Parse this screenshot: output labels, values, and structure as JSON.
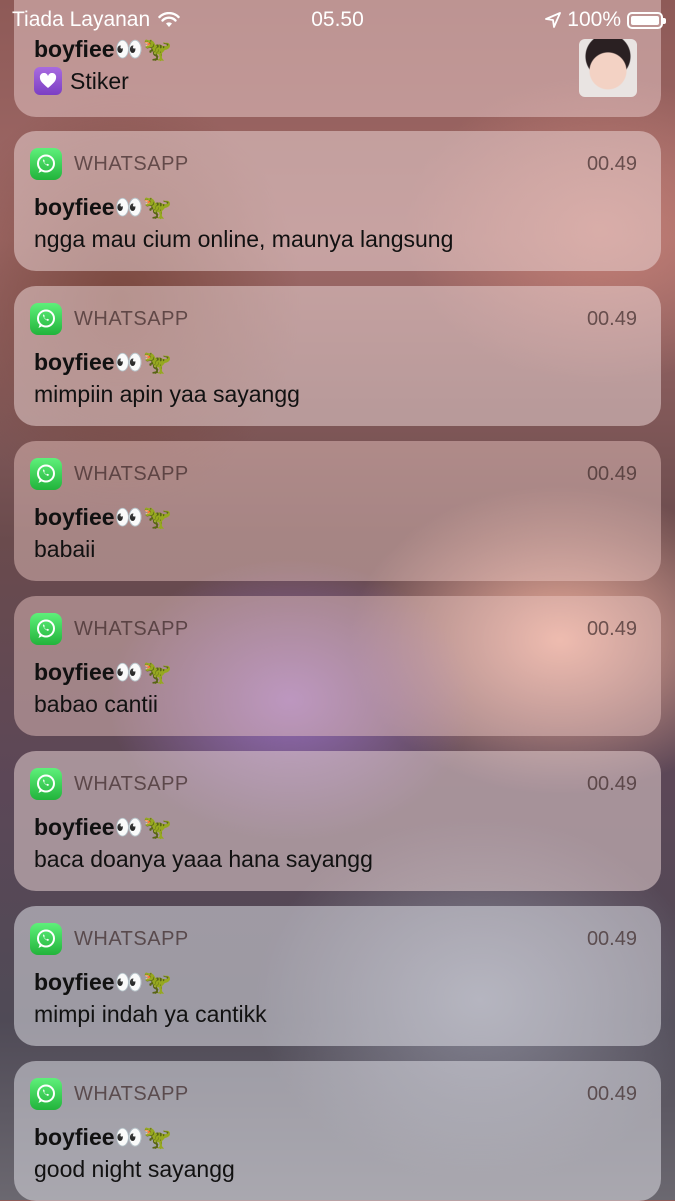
{
  "status_bar": {
    "carrier": "Tiada Layanan",
    "time": "05.50",
    "battery": "100%"
  },
  "top_notification": {
    "sender": "boyfiee👀🦖",
    "message": "Stiker"
  },
  "notifications": [
    {
      "app": "WHATSAPP",
      "time": "00.49",
      "sender": "boyfiee👀🦖",
      "message": "ngga mau cium online, maunya langsung"
    },
    {
      "app": "WHATSAPP",
      "time": "00.49",
      "sender": "boyfiee👀🦖",
      "message": "mimpiin apin yaa sayangg"
    },
    {
      "app": "WHATSAPP",
      "time": "00.49",
      "sender": "boyfiee👀🦖",
      "message": "babaii"
    },
    {
      "app": "WHATSAPP",
      "time": "00.49",
      "sender": "boyfiee👀🦖",
      "message": "babao cantii"
    },
    {
      "app": "WHATSAPP",
      "time": "00.49",
      "sender": "boyfiee👀🦖",
      "message": "baca doanya yaaa hana sayangg"
    },
    {
      "app": "WHATSAPP",
      "time": "00.49",
      "sender": "boyfiee👀🦖",
      "message": "mimpi indah ya cantikk"
    },
    {
      "app": "WHATSAPP",
      "time": "00.49",
      "sender": "boyfiee👀🦖",
      "message": "good night sayangg"
    }
  ],
  "icons": {
    "wifi": "wifi-icon",
    "location": "location-arrow-icon",
    "battery": "battery-icon",
    "app": "whatsapp-icon",
    "sticker": "purple-heart-icon"
  }
}
